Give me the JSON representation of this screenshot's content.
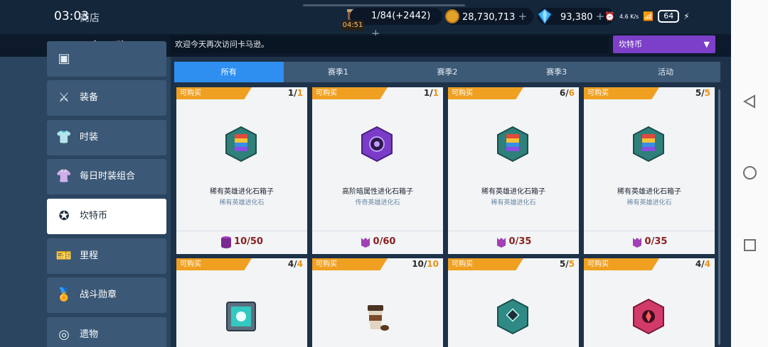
{
  "status_bar": {
    "time": "03:03",
    "network": "4.6 K/s",
    "battery": "64"
  },
  "header": {
    "title": "商店"
  },
  "resources": {
    "coffee": {
      "value": "1/84(+2442)",
      "timer": "04:51"
    },
    "gold": {
      "value": "28,730,713"
    },
    "gems": {
      "value": "93,380"
    },
    "plus": "+"
  },
  "logo": "卡马逊",
  "banner": {
    "text": "欢迎今天再次访问卡马逊。"
  },
  "currency_select": {
    "selected": "坎特币"
  },
  "sidebar": {
    "items": [
      {
        "label": "",
        "icon": "top-partial-icon"
      },
      {
        "label": "装备",
        "icon": "sword-icon"
      },
      {
        "label": "时装",
        "icon": "shirt-icon"
      },
      {
        "label": "每日时装组合",
        "icon": "outfit-set-icon"
      },
      {
        "label": "坎特币",
        "icon": "cantcoin-icon",
        "active": true
      },
      {
        "label": "里程",
        "icon": "ticket-icon"
      },
      {
        "label": "战斗勋章",
        "icon": "medal-icon"
      },
      {
        "label": "遗物",
        "icon": "relic-icon"
      }
    ]
  },
  "tabs": [
    {
      "label": "所有",
      "active": true
    },
    {
      "label": "赛季1"
    },
    {
      "label": "赛季2"
    },
    {
      "label": "赛季3"
    },
    {
      "label": "活动"
    }
  ],
  "badge_label": "可购买",
  "cards": [
    {
      "count": "1",
      "max": "1",
      "name": "稀有英雄进化石箱子",
      "sub": "稀有英雄进化石",
      "price": "10/50",
      "price_icon": "coin-stack-icon",
      "item": "rare-crate"
    },
    {
      "count": "1",
      "max": "1",
      "name": "高阶暗属性进化石箱子",
      "sub": "传奇英雄进化石",
      "price": "0/60",
      "price_icon": "demon-coin-icon",
      "item": "dark-crate"
    },
    {
      "count": "6",
      "max": "6",
      "name": "稀有英雄进化石箱子",
      "sub": "稀有英雄进化石",
      "price": "0/35",
      "price_icon": "demon-coin-icon",
      "item": "rare-crate"
    },
    {
      "count": "5",
      "max": "5",
      "name": "稀有英雄进化石箱子",
      "sub": "稀有英雄进化石",
      "price": "0/35",
      "price_icon": "demon-coin-icon",
      "item": "rare-crate"
    },
    {
      "count": "4",
      "max": "4",
      "item": "glow-box"
    },
    {
      "count": "10",
      "max": "10",
      "item": "coffee-cup"
    },
    {
      "count": "5",
      "max": "5",
      "item": "teal-crate"
    },
    {
      "count": "4",
      "max": "4",
      "item": "pink-crate"
    }
  ],
  "colors": {
    "accent_orange": "#f0a021",
    "tab_active": "#2e8ff0",
    "select_purple": "#7b3fc9",
    "price_red": "#8a1f1f"
  }
}
